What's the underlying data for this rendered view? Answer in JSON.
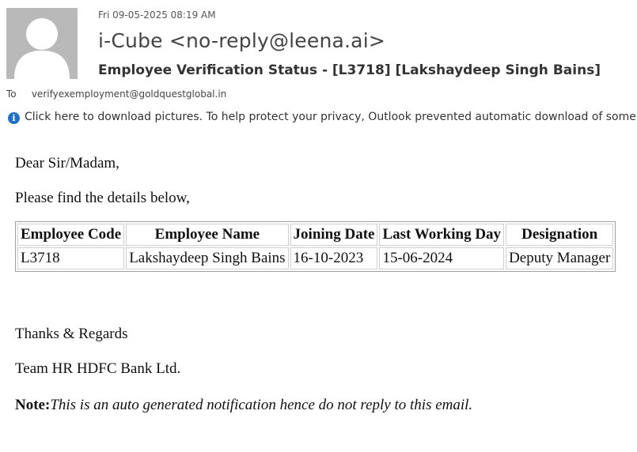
{
  "message": {
    "date": "Fri 09-05-2025 08:19 AM",
    "sender": "i-Cube <no-reply@leena.ai>",
    "subject": "Employee Verification Status - [L3718] [Lakshaydeep Singh Bains]",
    "to_label": "To",
    "to_address": "verifyexemployment@goldquestglobal.in",
    "info_bar": "Click here to download pictures. To help protect your privacy, Outlook prevented automatic download of some pictures in this message."
  },
  "body": {
    "greeting": "Dear Sir/Madam,",
    "intro": "Please find the details below,",
    "table": {
      "headers": [
        "Employee Code",
        "Employee Name",
        "Joining Date",
        "Last Working Day",
        "Designation"
      ],
      "rows": [
        [
          "L3718",
          "Lakshaydeep Singh Bains",
          "16-10-2023",
          "15-06-2024",
          "Deputy Manager"
        ]
      ]
    },
    "thanks": "Thanks & Regards",
    "team": "Team HR HDFC Bank Ltd.",
    "note_label": "Note:",
    "note_text": "This is an auto generated notification hence do not reply to this email."
  },
  "icons": {
    "avatar": "person-placeholder-icon",
    "info": "info-icon"
  },
  "colors": {
    "avatar_bg": "#b9b9b9",
    "info_icon": "#1f6fc5"
  }
}
